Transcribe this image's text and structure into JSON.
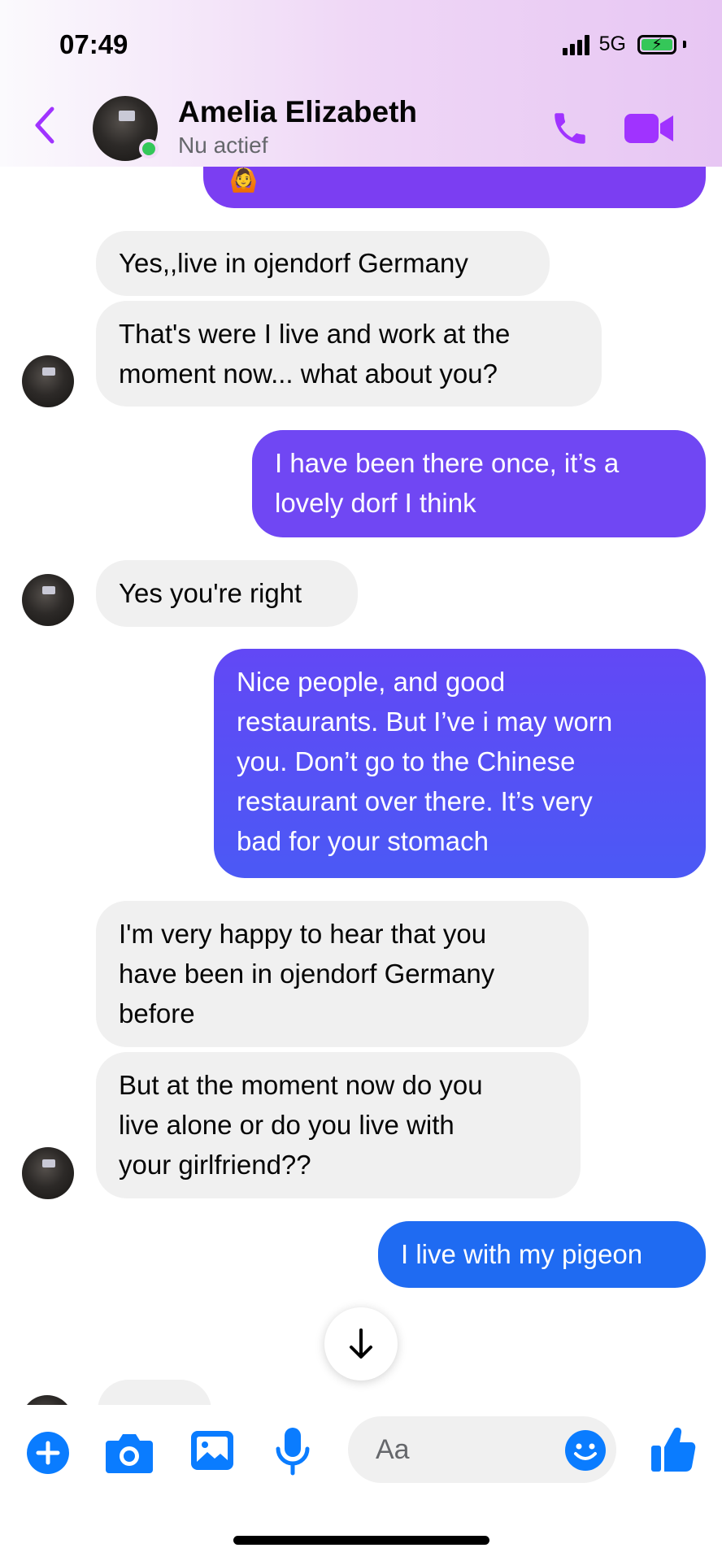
{
  "status_bar": {
    "time": "07:49",
    "network": "5G"
  },
  "header": {
    "contact_name": "Amelia Elizabeth",
    "contact_status": "Nu actief"
  },
  "messages": [
    {
      "from": "contact",
      "text_lines": [
        "Yes,,live in ojendorf Germany"
      ]
    },
    {
      "from": "contact",
      "text_lines": [
        "That's were I live and work at the",
        "moment now... what about you?"
      ]
    },
    {
      "from": "me",
      "text_lines": [
        "I have been there once, it’s a",
        "lovely dorf I think"
      ]
    },
    {
      "from": "contact",
      "text_lines": [
        "Yes you're right"
      ]
    },
    {
      "from": "me",
      "text_lines": [
        "Nice people, and good",
        "restaurants. But I’ve i may worn",
        "you. Don’t go to the Chinese",
        "restaurant over there. It’s very",
        "bad for your stomach"
      ]
    },
    {
      "from": "contact",
      "text_lines": [
        "I'm very happy to hear that you",
        "have been in ojendorf Germany",
        "before"
      ]
    },
    {
      "from": "contact",
      "text_lines": [
        "But at the moment now do you",
        "live alone or do you live with",
        "your girlfriend??"
      ]
    },
    {
      "from": "me",
      "text_lines": [
        "I live with my pigeon"
      ]
    }
  ],
  "composer": {
    "placeholder": "Aa"
  },
  "colors": {
    "sent_purple": "#7b3ef2",
    "sent_violet": "#6248f5",
    "sent_blue": "#1f6bf2",
    "received_gray": "#f0f0f0",
    "accent_purple": "#a033ff",
    "composer_blue": "#0a7cff",
    "online_green": "#34c759"
  },
  "icons": [
    "back-chevron-icon",
    "phone-icon",
    "video-camera-icon",
    "arrow-down-icon",
    "plus-icon",
    "camera-icon",
    "gallery-icon",
    "microphone-icon",
    "emoji-icon",
    "thumbs-up-icon"
  ]
}
